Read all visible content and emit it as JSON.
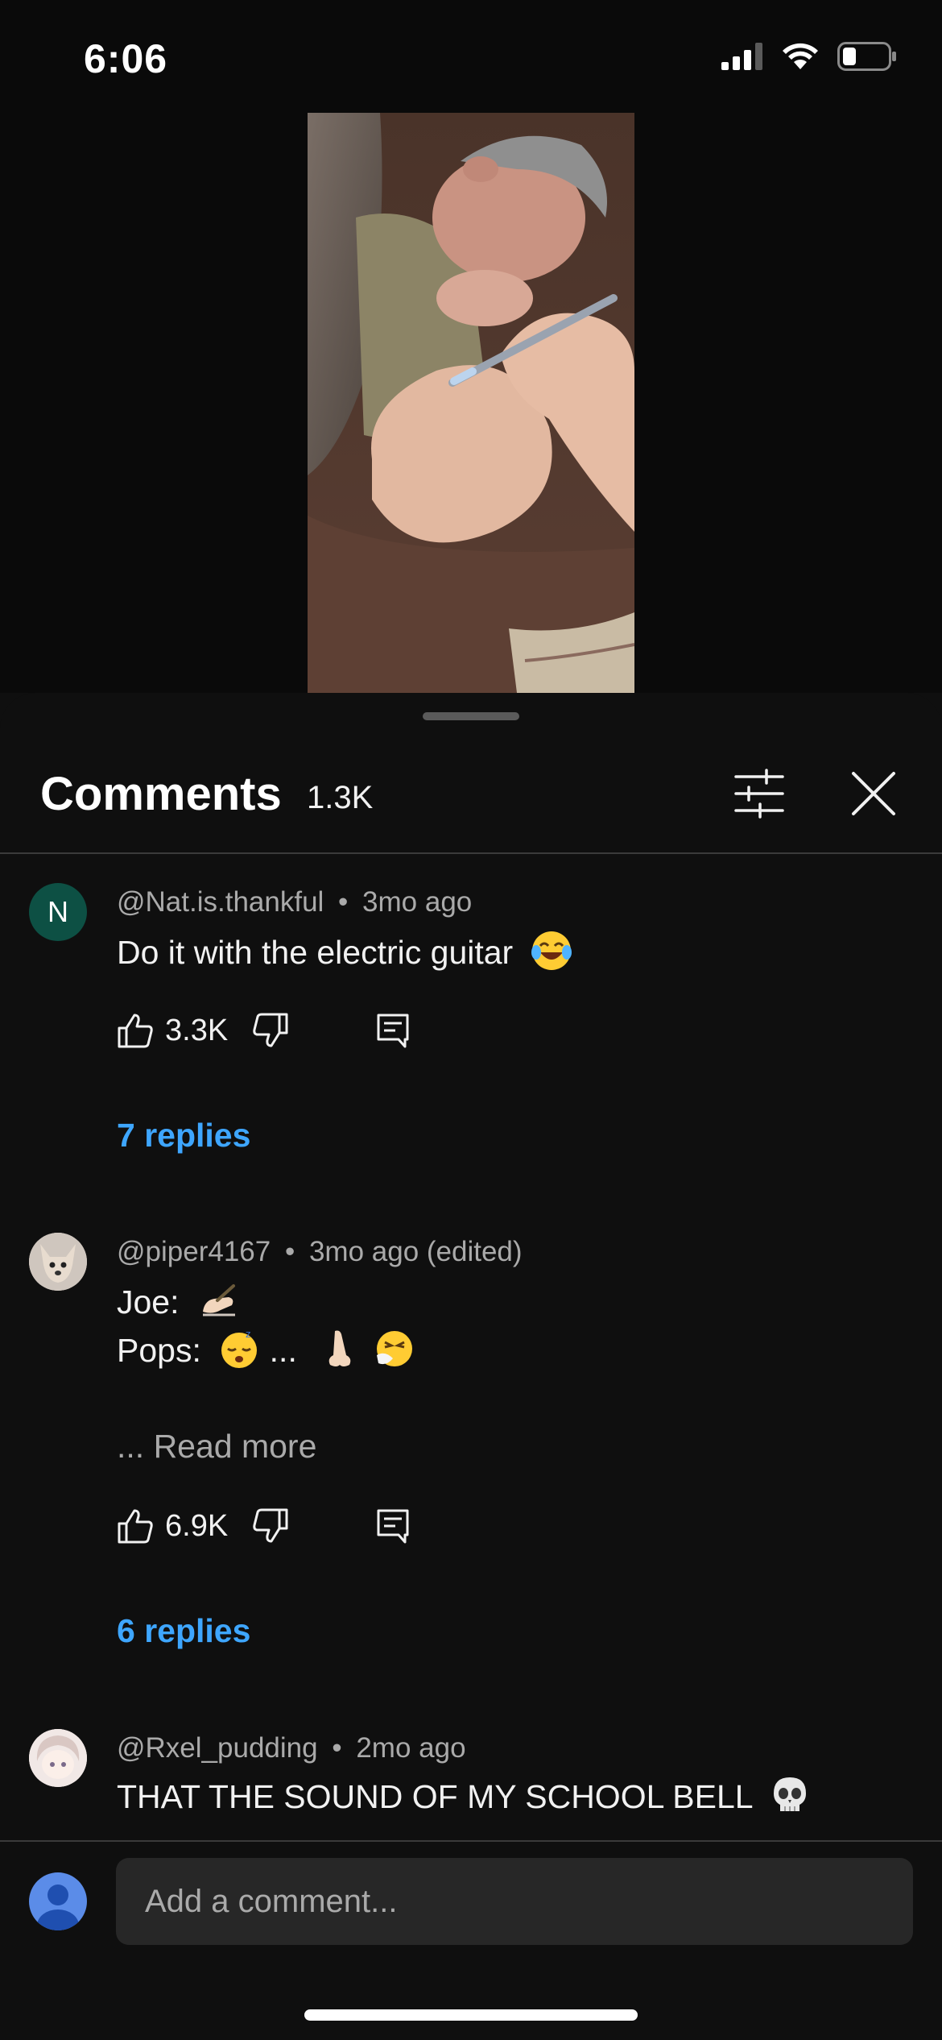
{
  "status_bar": {
    "time": "6:06",
    "icons": [
      "cellular-signal-icon",
      "wifi-icon",
      "battery-icon"
    ]
  },
  "video": {
    "thumbnail_icon": "video-frame"
  },
  "comments_sheet": {
    "title": "Comments",
    "count": "1.3K",
    "filter_icon": "sliders-icon",
    "close_icon": "close-icon"
  },
  "comments": [
    {
      "avatar_letter": "N",
      "author": "@Nat.is.thankful",
      "separator": "•",
      "time": "3mo ago",
      "text_lines": [
        "Do it with the electric guitar"
      ],
      "likes": "3.3K",
      "replies_label": "7 replies"
    },
    {
      "author": "@piper4167",
      "separator": "•",
      "time": "3mo ago (edited)",
      "text_lines": [
        "Joe:",
        "Pops:",
        "..."
      ],
      "read_more": "... Read more",
      "likes": "6.9K",
      "replies_label": "6 replies"
    },
    {
      "author": "@Rxel_pudding",
      "separator": "•",
      "time": "2mo ago",
      "text_lines": [
        "THAT THE SOUND OF MY SCHOOL BELL"
      ]
    }
  ],
  "input": {
    "placeholder": "Add a comment..."
  },
  "colors": {
    "background": "#0f0f0f",
    "link_blue": "#3ea6ff",
    "secondary_text": "#aaaaaa",
    "avatar_green": "#0d5044"
  }
}
